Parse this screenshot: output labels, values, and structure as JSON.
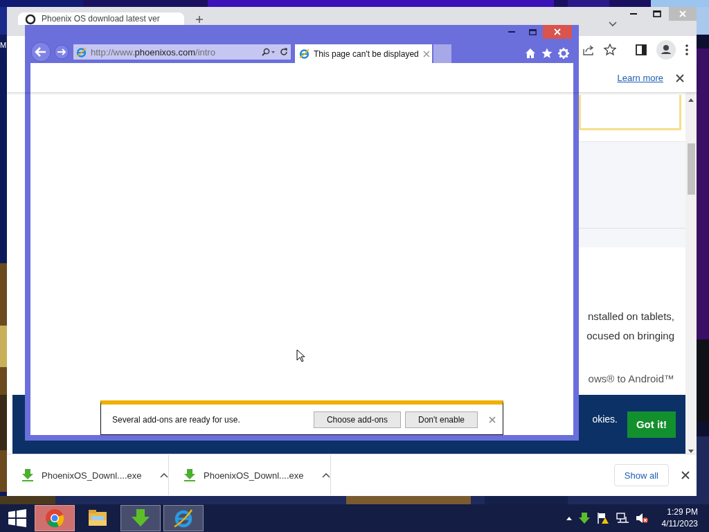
{
  "desktop": {
    "icon_label": "M"
  },
  "chrome": {
    "tab_title": "Phoenix OS download latest ver",
    "info_bar": {
      "link": "Learn more"
    },
    "page": {
      "lines": [
        "nstalled on tablets,",
        "ocused on bringing",
        "ows® to Android™"
      ],
      "cookie_banner": {
        "text": "okies.",
        "button": "Got it!"
      }
    },
    "downloads": [
      {
        "name": "PhoenixOS_Downl....exe"
      },
      {
        "name": "PhoenixOS_Downl....exe"
      }
    ],
    "show_all": "Show all"
  },
  "ie": {
    "address": "http://www.**phoenixos.com**/intro",
    "tabs": [
      {
        "title": "This page can't be displayed",
        "selected": true
      }
    ],
    "notification": {
      "message": "Several add-ons are ready for use.",
      "buttons": [
        "Choose add-ons",
        "Don't enable"
      ]
    }
  },
  "taskbar": {
    "apps": [
      {
        "kind": "chrome",
        "running": true,
        "attention": true
      },
      {
        "kind": "explorer",
        "running": false,
        "attention": false
      },
      {
        "kind": "download",
        "running": true,
        "attention": false
      },
      {
        "kind": "ie",
        "running": true,
        "attention": false
      }
    ],
    "clock": {
      "time": "1:29 PM",
      "date": "4/11/2023"
    }
  }
}
